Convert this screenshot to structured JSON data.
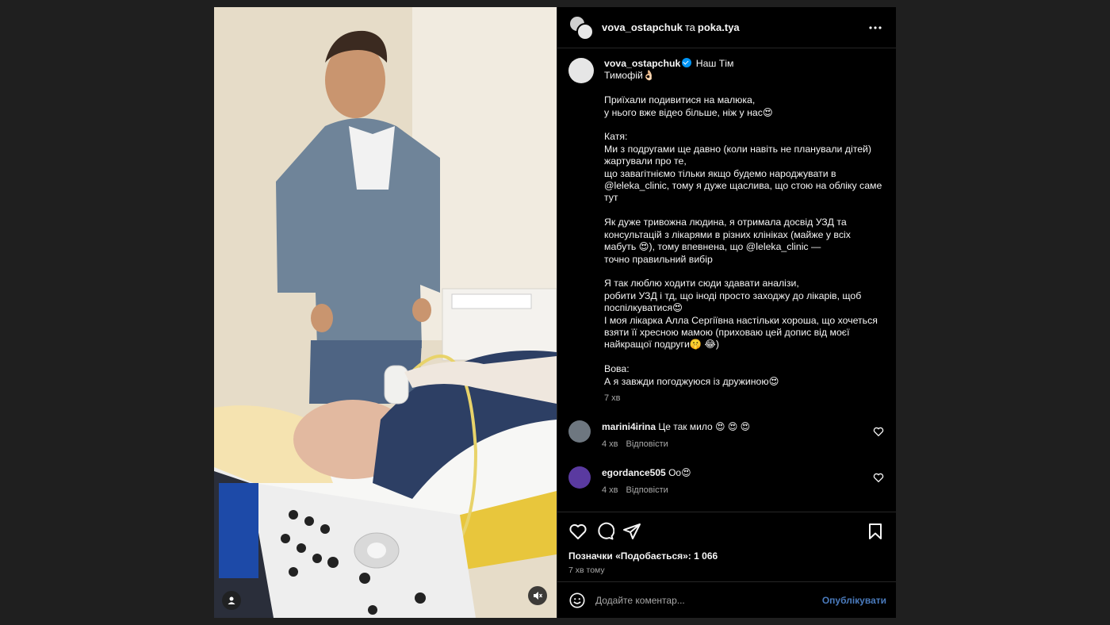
{
  "header": {
    "user1": "vova_ostapchuk",
    "conj": "та",
    "user2": "poka.tya"
  },
  "caption": {
    "username": "vova_ostapchuk",
    "text": "Наш Тім\nТимофій👌🏻\n\nПриїхали подивитися на малюка,\nу нього вже відео більше, ніж у нас😍\n\nКатя:\nМи з подругами ще давно (коли навіть не планували дітей) жартували про те,\nщо завагітніємо тільки якщо будемо народжувати в @leleka_clinic, тому я дуже щаслива, що стою на обліку саме тут\n\nЯк дуже тривожна людина, я отримала досвід УЗД та консультацій з лікарями в різних клініках (майже у всіх мабуть 😍), тому впевнена, що @leleka_clinic —\nточно правильний вибір\n\nЯ так люблю ходити сюди здавати аналізи,\nробити УЗД і тд, що іноді просто заходжу до лікарів, щоб поспілкуватися😍\nІ моя лікарка Алла Сергіївна настільки хороша, що хочеться взяти її хресною мамою (приховаю цей допис від моєї найкращої подруги🤫 😂)\n\nВова:\nА я завжди погоджуюся із дружиною😍",
    "time": "7 хв"
  },
  "comments": [
    {
      "username": "marini4irina",
      "text": "Це так мило 😍 😍 😍",
      "time": "4 хв",
      "reply": "Відповісти"
    },
    {
      "username": "egordance505",
      "text": "Оо😍",
      "time": "4 хв",
      "reply": "Відповісти"
    }
  ],
  "likes": "Позначки «Подобається»: 1 066",
  "post_time": "7 хв тому",
  "add_comment": {
    "placeholder": "Додайте коментар...",
    "post": "Опублікувати"
  },
  "colors": {
    "background": "#1f1f1f",
    "panel": "#000000",
    "verified": "#0095f6",
    "link": "#4a7bbd"
  },
  "icons": [
    "more-icon",
    "verified-icon",
    "heart-icon",
    "comment-icon",
    "share-icon",
    "bookmark-icon",
    "emoji-icon",
    "user-tag-icon",
    "mute-icon"
  ]
}
